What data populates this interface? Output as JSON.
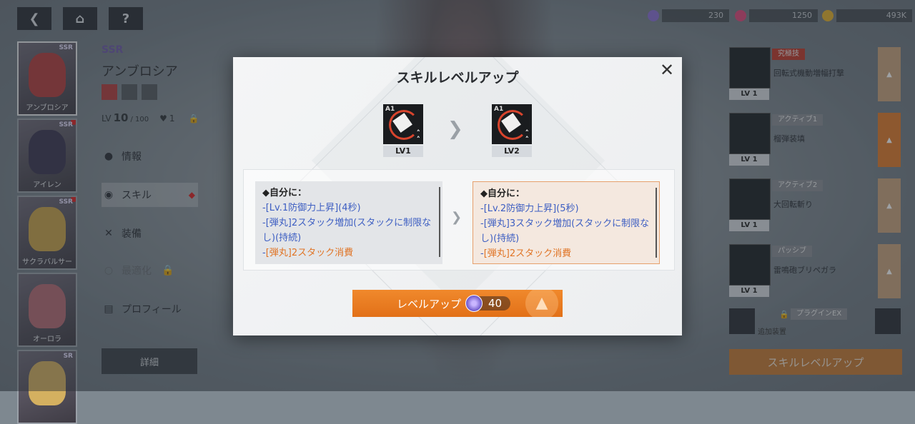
{
  "top": {
    "currencies": [
      {
        "icon": "purple-gem-icon",
        "value": "230",
        "color": "#8a6fd6"
      },
      {
        "icon": "pink-gem-icon",
        "value": "1250",
        "color": "#e0487a"
      },
      {
        "icon": "gold-coin-icon",
        "value": "493K",
        "color": "#e6b12a"
      }
    ]
  },
  "character": {
    "rarity": "SSR",
    "name": "アンブロシア",
    "level_prefix": "LV",
    "level": "10",
    "level_max": "/ 100",
    "likes": "1"
  },
  "roster": [
    {
      "name": "アンブロシア",
      "rarity": "SSR",
      "color": "#b33c3c"
    },
    {
      "name": "アイレン",
      "rarity": "SSR",
      "color": "#3b3550"
    },
    {
      "name": "サクラバルサー",
      "rarity": "SSR",
      "color": "#c8a24a"
    },
    {
      "name": "オーロラ",
      "rarity": "",
      "color": "#b56a74"
    },
    {
      "name": "",
      "rarity": "SR",
      "color": "#d4b060"
    }
  ],
  "menu": [
    {
      "label": "情報",
      "icon": "info-icon"
    },
    {
      "label": "スキル",
      "icon": "skill-icon"
    },
    {
      "label": "装備",
      "icon": "equipment-icon"
    },
    {
      "label": "最適化",
      "icon": "optimize-icon"
    },
    {
      "label": "プロフィール",
      "icon": "profile-icon"
    }
  ],
  "detail_btn": "詳細",
  "right_skills": [
    {
      "tag": "究極技",
      "name": "回転式機動増幅打撃",
      "lv": "LV 1",
      "tag_color": "#c0392b"
    },
    {
      "tag": "アクティブ1",
      "name": "榴弾装填",
      "lv": "LV 1",
      "tag_color": "#8a8f96"
    },
    {
      "tag": "アクティブ2",
      "name": "大回転斬り",
      "lv": "LV 1",
      "tag_color": "#8a8f96"
    },
    {
      "tag": "パッシブ",
      "name": "雷鳴砲ブリペガラ",
      "lv": "LV 1",
      "tag_color": "#8a8f96"
    }
  ],
  "plugin": {
    "tag": "プラグインEX",
    "name": "追加装置"
  },
  "skill_levelup_btn": "スキルレベルアップ",
  "modal": {
    "title": "スキルレベルアップ",
    "icon_tag": "A1",
    "from_lv": "LV1",
    "to_lv": "LV2",
    "current": {
      "heading": "◆自分に：",
      "line1": "-[Lv.1防御力上昇](4秒)",
      "line2": "-[弾丸]2スタック増加(スタックに制限なし)(持続)",
      "line3_prefix": "-",
      "line3": "[弾丸]2スタック消費"
    },
    "next": {
      "heading": "◆自分に：",
      "line1": "-[Lv.2防御力上昇](5秒)",
      "line2": "-[弾丸]3スタック増加(スタックに制限なし)(持続)",
      "line3_prefix": "-",
      "line3": "[弾丸]2スタック消費"
    },
    "button": {
      "label": "レベルアップ",
      "cost": "40"
    }
  }
}
